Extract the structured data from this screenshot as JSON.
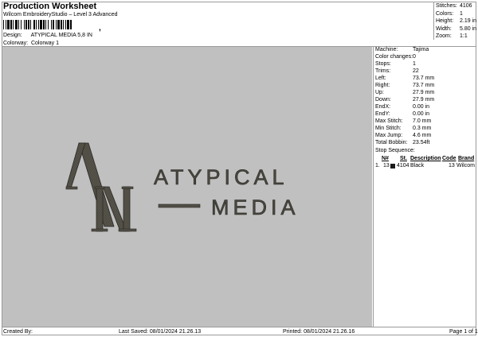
{
  "header": {
    "title": "Production Worksheet",
    "subtitle": "Wilcom EmbroideryStudio – Level 3 Advanced",
    "barcode_mark": ","
  },
  "design": {
    "label": "Design:",
    "value": "ATYPICAL MEDIA 5,8 IN"
  },
  "colorway": {
    "label": "Colorway:",
    "value": "Colorway 1"
  },
  "stats": [
    {
      "label": "Stitches:",
      "value": "4106"
    },
    {
      "label": "Colors:",
      "value": "1"
    },
    {
      "label": "Height:",
      "value": "2.19 in"
    },
    {
      "label": "Width:",
      "value": "5.80 in"
    },
    {
      "label": "Zoom:",
      "value": "1:1"
    }
  ],
  "info": [
    {
      "label": "Machine:",
      "value": "Tajima"
    },
    {
      "label": "Color changes:",
      "value": "0"
    },
    {
      "label": "Stops:",
      "value": "1"
    },
    {
      "label": "Trims:",
      "value": "22"
    },
    {
      "label": "Left:",
      "value": "73.7 mm"
    },
    {
      "label": "Right:",
      "value": "73.7 mm"
    },
    {
      "label": "Up:",
      "value": "27.9 mm"
    },
    {
      "label": "Down:",
      "value": "27.9 mm"
    },
    {
      "label": "EndX:",
      "value": "0.00 in"
    },
    {
      "label": "EndY:",
      "value": "0.00 in"
    },
    {
      "label": "Max Stitch:",
      "value": "7.0 mm"
    },
    {
      "label": "Min Stitch:",
      "value": "0.3 mm"
    },
    {
      "label": "Max Jump:",
      "value": "4.6 mm"
    },
    {
      "label": "Total Bobbin:",
      "value": "23.54ft"
    }
  ],
  "stop_sequence": {
    "title": "Stop Sequence:",
    "columns": {
      "num": "N#",
      "st": "St.",
      "description": "Description",
      "code": "Code",
      "brand": "Brand"
    },
    "rows": [
      {
        "idx": "1.",
        "num": "13",
        "st": "4104",
        "description": "Black",
        "code": "13",
        "brand": "Wilcom",
        "color": "#1a1a1a"
      }
    ]
  },
  "artwork": {
    "line1": "ATYPICAL",
    "line2": "MEDIA",
    "monogram_a": "A",
    "monogram_m": "M",
    "thread_color": "#4a4840"
  },
  "footer": {
    "created": "Created By:",
    "last_saved": "Last Saved: 08/01/2024 21.26.13",
    "printed": "Printed: 08/01/2024 21.26.16",
    "page": "Page 1 of 1"
  }
}
